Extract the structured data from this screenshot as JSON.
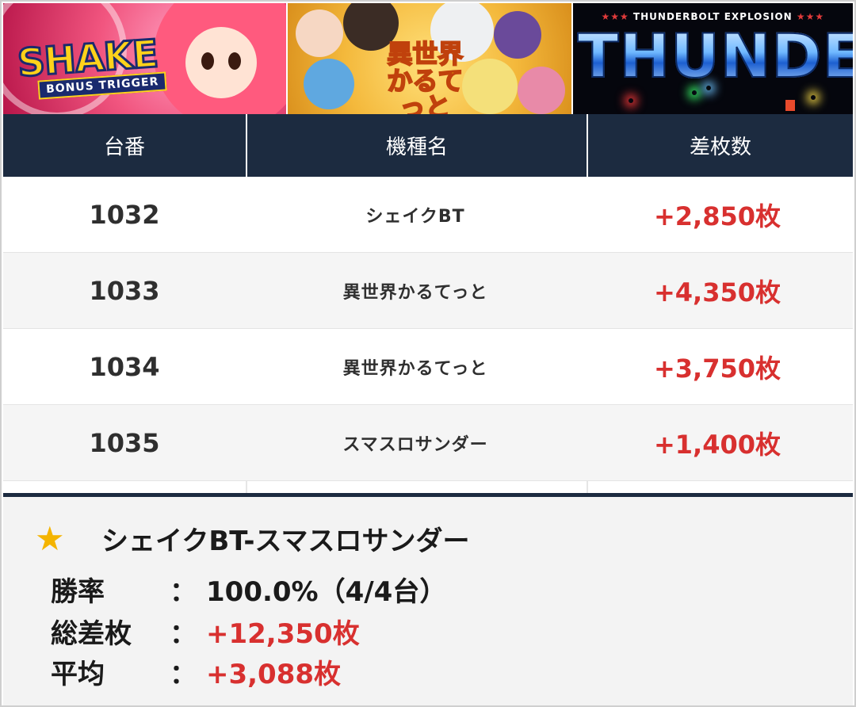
{
  "banners": {
    "shake": {
      "logo": "SHAKE",
      "sub": "BONUS TRIGGER"
    },
    "isekai": {
      "logo": "異世界かるてっと"
    },
    "thunder": {
      "top": "THUNDERBOLT EXPLOSION",
      "title": "THUNDER"
    }
  },
  "table": {
    "headers": [
      "台番",
      "機種名",
      "差枚数"
    ],
    "rows": [
      {
        "number": "1032",
        "machine": "シェイクBT",
        "diff": "+2,850枚"
      },
      {
        "number": "1033",
        "machine": "異世界かるてっと",
        "diff": "+4,350枚"
      },
      {
        "number": "1034",
        "machine": "異世界かるてっと",
        "diff": "+3,750枚"
      },
      {
        "number": "1035",
        "machine": "スマスロサンダー",
        "diff": "+1,400枚"
      }
    ]
  },
  "summary": {
    "star": "★",
    "title": "シェイクBT-スマスロサンダー",
    "colon": "：",
    "win_rate_label": "勝率",
    "win_rate_value": "100.0%（4/4台）",
    "total_label": "総差枚",
    "total_value": "+12,350枚",
    "average_label": "平均",
    "average_value": "+3,088枚"
  },
  "colors": {
    "header_bg": "#1c2b40",
    "positive": "#d8302f",
    "star": "#f4b400"
  }
}
